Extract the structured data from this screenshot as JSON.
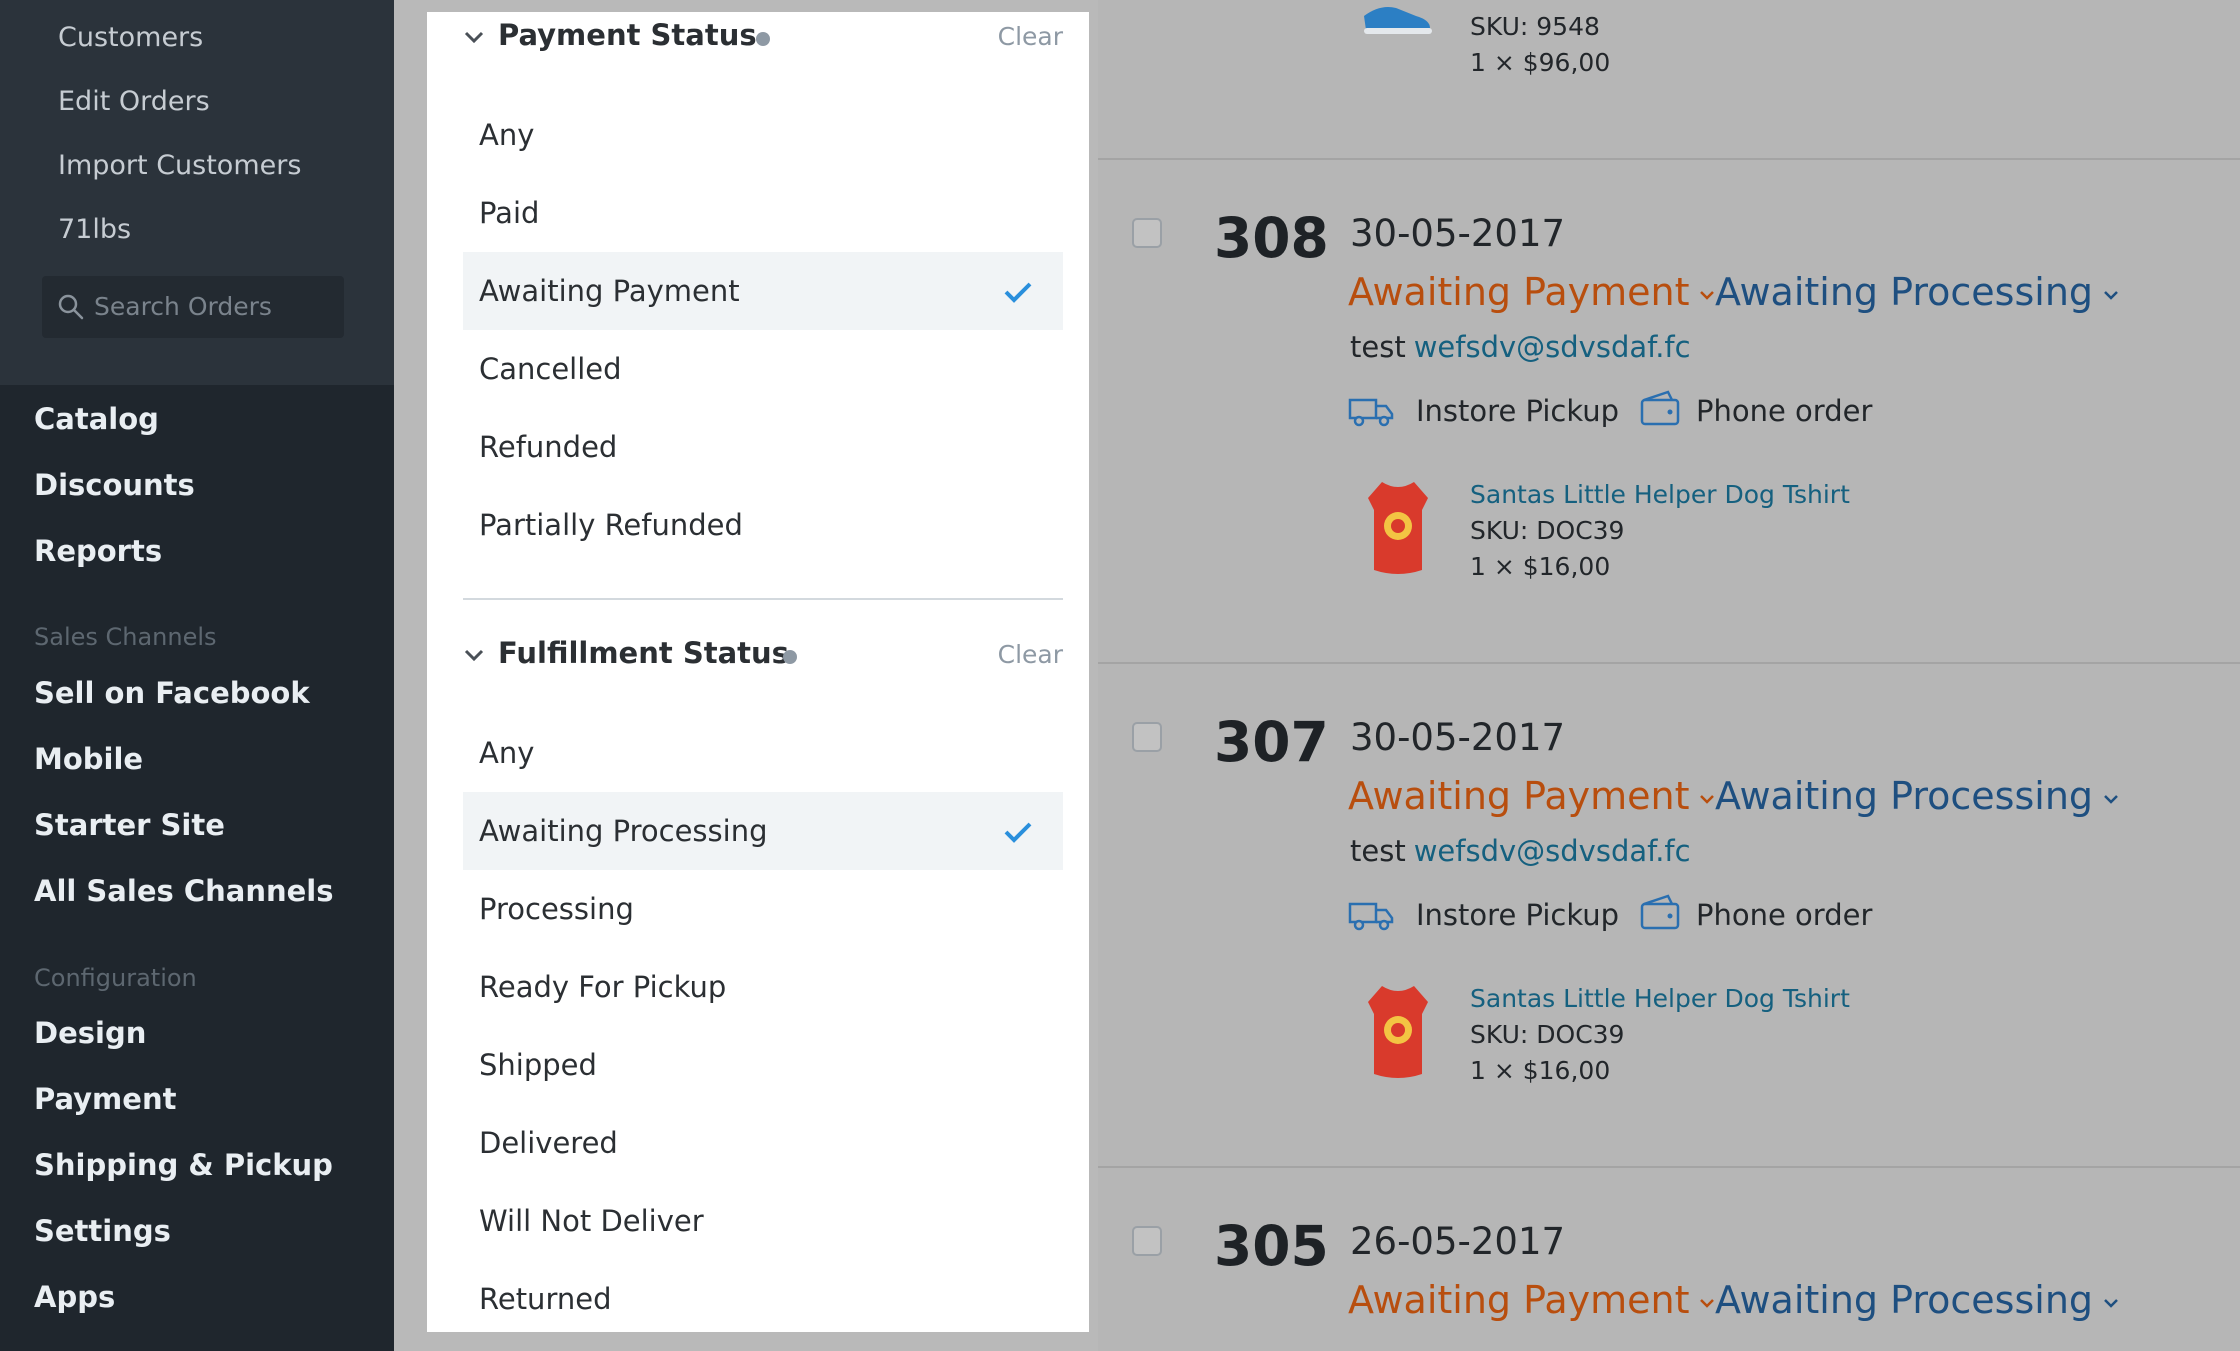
{
  "sidebar": {
    "sub_items": [
      "Customers",
      "Edit Orders",
      "Import Customers",
      "71lbs"
    ],
    "search_placeholder": "Search Orders",
    "main_items": [
      "Catalog",
      "Discounts",
      "Reports"
    ],
    "sales_channels_label": "Sales Channels",
    "sales_channels": [
      "Sell on Facebook",
      "Mobile",
      "Starter Site",
      "All Sales Channels"
    ],
    "configuration_label": "Configuration",
    "configuration": [
      "Design",
      "Payment",
      "Shipping & Pickup",
      "Settings",
      "Apps"
    ]
  },
  "filters": {
    "payment": {
      "title": "Payment Status",
      "clear": "Clear",
      "options": [
        "Any",
        "Paid",
        "Awaiting Payment",
        "Cancelled",
        "Refunded",
        "Partially Refunded"
      ],
      "selected": "Awaiting Payment"
    },
    "fulfillment": {
      "title": "Fulfillment Status",
      "clear": "Clear",
      "options": [
        "Any",
        "Awaiting Processing",
        "Processing",
        "Ready For Pickup",
        "Shipped",
        "Delivered",
        "Will Not Deliver",
        "Returned"
      ],
      "selected": "Awaiting Processing"
    }
  },
  "orders": {
    "partial_top": {
      "sku": "SKU: 9548",
      "qty_price": "1 × $96,00"
    },
    "list": [
      {
        "number": "308",
        "date": "30-05-2017",
        "payment_status": "Awaiting Payment",
        "fulfillment_status": "Awaiting Processing",
        "customer_name": "test",
        "customer_email": "wefsdv@sdvsdaf.fc",
        "shipping": "Instore Pickup",
        "source": "Phone order",
        "product_name": "Santas Little Helper Dog Tshirt",
        "sku": "SKU: DOC39",
        "qty_price": "1 × $16,00"
      },
      {
        "number": "307",
        "date": "30-05-2017",
        "payment_status": "Awaiting Payment",
        "fulfillment_status": "Awaiting Processing",
        "customer_name": "test",
        "customer_email": "wefsdv@sdvsdaf.fc",
        "shipping": "Instore Pickup",
        "source": "Phone order",
        "product_name": "Santas Little Helper Dog Tshirt",
        "sku": "SKU: DOC39",
        "qty_price": "1 × $16,00"
      },
      {
        "number": "305",
        "date": "26-05-2017",
        "payment_status": "Awaiting Payment",
        "fulfillment_status": "Awaiting Processing"
      }
    ]
  },
  "colors": {
    "sidebar_bg": "#1f262d",
    "payment_status": "#b84e0e",
    "fulfillment_status": "#1e4f80",
    "link": "#15607f",
    "check": "#2a8fdc"
  }
}
